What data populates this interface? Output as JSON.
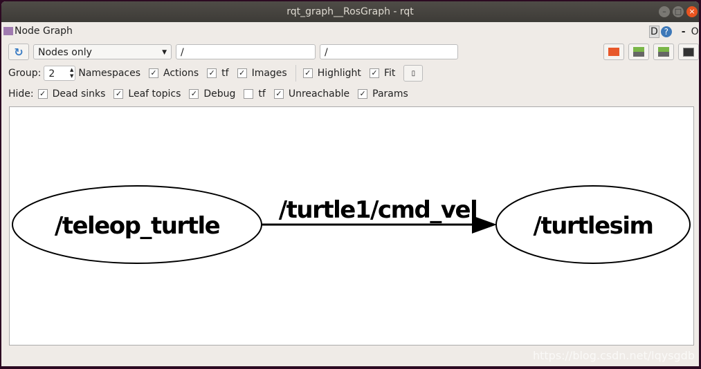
{
  "window": {
    "title": "rqt_graph__RosGraph - rqt"
  },
  "plugin": {
    "title": "Node Graph",
    "d_label": "D",
    "help": "?",
    "minus": "-",
    "o": "O"
  },
  "toolbar": {
    "mode": "Nodes only",
    "filter1": "/",
    "filter2": "/"
  },
  "options": {
    "group_label": "Group:",
    "group_value": "2",
    "items": [
      {
        "label": "Namespaces",
        "checkbox": false
      },
      {
        "label": "Actions",
        "checked": true
      },
      {
        "label": "tf",
        "checked": true
      },
      {
        "label": "Images",
        "checked": true
      },
      {
        "label": "Highlight",
        "checked": true
      },
      {
        "label": "Fit",
        "checked": true
      }
    ]
  },
  "hide": {
    "label": "Hide:",
    "items": [
      {
        "label": "Dead sinks",
        "checked": true
      },
      {
        "label": "Leaf topics",
        "checked": true
      },
      {
        "label": "Debug",
        "checked": true
      },
      {
        "label": "tf",
        "checked": false
      },
      {
        "label": "Unreachable",
        "checked": true
      },
      {
        "label": "Params",
        "checked": true
      }
    ]
  },
  "graph": {
    "nodes": [
      "/teleop_turtle",
      "/turtlesim"
    ],
    "edge": "/turtle1/cmd_vel"
  },
  "watermark": "https://blog.csdn.net/lqysgdb"
}
